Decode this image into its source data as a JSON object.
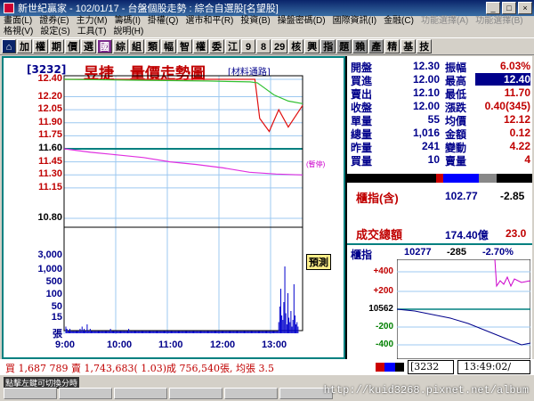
{
  "window": {
    "title": "新世紀贏家 - 102/01/17 - 台盤個股走勢 : 綜合自選股[名望股]"
  },
  "menu": {
    "row1": [
      "畫面(L)",
      "證券(E)",
      "主力(M)",
      "籌碼(I)",
      "掛權(Q)",
      "選市和平(R)",
      "投資(B)",
      "操盤密碼(D)",
      "國際資訊(I)",
      "金融(C)",
      "功能選擇(A)",
      "功能選擇(B)"
    ],
    "row2": [
      "格視(V)",
      "設定(S)",
      "工具(T)",
      "說明(H)"
    ]
  },
  "toolbar": [
    "加",
    "權",
    "期",
    "價",
    "選",
    "國",
    "綜",
    "組",
    "類",
    "幅",
    "智",
    "權",
    "委",
    "江",
    "9",
    "8",
    "29",
    "核",
    "興",
    "指",
    "題",
    "賴",
    "產",
    "精",
    "基",
    "技"
  ],
  "header": {
    "code": "[3232]",
    "name": "昱捷",
    "title": "量價走勢圖",
    "news": "[材料通路]"
  },
  "price_axis": {
    "ticks": [
      "12.40",
      "12.20",
      "12.05",
      "11.90",
      "11.75",
      "11.60",
      "11.45",
      "11.30",
      "11.15",
      "10.80"
    ],
    "volume_ticks": [
      "3,000",
      "1,000",
      "500",
      "100",
      "50",
      "15"
    ],
    "volume_unit": "張"
  },
  "time_axis": [
    "9:00",
    "10:00",
    "11:00",
    "12:00",
    "13:00"
  ],
  "chart_data": {
    "type": "line",
    "title": "量價走勢圖",
    "x": [
      "9:00",
      "10:00",
      "11:00",
      "12:00",
      "13:00"
    ],
    "series": [
      {
        "name": "",
        "values": [
          12.4,
          12.4,
          12.4,
          12.4,
          12.4,
          11.95,
          11.8,
          12.05,
          11.85,
          12.1
        ]
      },
      {
        "name": "",
        "values": [
          12.4,
          12.39,
          12.38,
          12.37,
          12.36,
          12.3,
          12.22,
          12.15,
          12.12
        ]
      },
      {
        "name": "",
        "values": [
          11.6,
          11.56,
          11.53,
          11.5,
          11.45,
          11.42,
          11.38,
          11.33,
          11.31,
          11.3
        ]
      }
    ],
    "ylim": [
      10.8,
      12.4
    ],
    "reference_level": 11.6,
    "label_stopped": "(暫停)"
  },
  "quote": {
    "rows": [
      {
        "l1": "開盤",
        "v1": "12.30",
        "l2": "振幅",
        "v2": "6.03%"
      },
      {
        "l1": "買進",
        "v1": "12.00",
        "l2": "最高",
        "v2": "12.40"
      },
      {
        "l1": "賣出",
        "v1": "12.10",
        "l2": "最低",
        "v2": "11.70"
      },
      {
        "l1": "收盤",
        "v1": "12.00",
        "l2": "漲跌",
        "v2": "0.40(345)"
      },
      {
        "l1": "單量",
        "v1": "55",
        "l2": "均價",
        "v2": "12.12"
      },
      {
        "l1": "總量",
        "v1": "1,016",
        "l2": "金額",
        "v2": "0.12"
      },
      {
        "l1": "昨量",
        "v1": "241",
        "l2": "變動",
        "v2": "4.22"
      },
      {
        "l1": "買量",
        "v1": "10",
        "l2": "賣量",
        "v2": "4"
      }
    ]
  },
  "index": {
    "label": "櫃指(含)",
    "value": "102.77",
    "change": "-2.85"
  },
  "turnover": {
    "label": "成交總額",
    "value": "174.40億",
    "extra": "23.0"
  },
  "mini": {
    "label": "櫃指",
    "value": "10277",
    "change": "-285",
    "pct": "-2.70%",
    "ticks": [
      "+400",
      "+200",
      "10562",
      "-200",
      "-400"
    ],
    "reserve_label": "預測"
  },
  "status": {
    "text": "買 1,687 789 賣 1,743,683( 1.03)成 756,540張, 均張 3.5",
    "code_box": "[3232",
    "clock": "13:49:02/"
  },
  "taskbar": {
    "url": "http://kuid3268.pixnet.net/album",
    "hint": "點擊左鍵可切換分時"
  },
  "colors": {
    "accent": "#c00000",
    "blue": "#00008b",
    "teal": "#008080"
  }
}
